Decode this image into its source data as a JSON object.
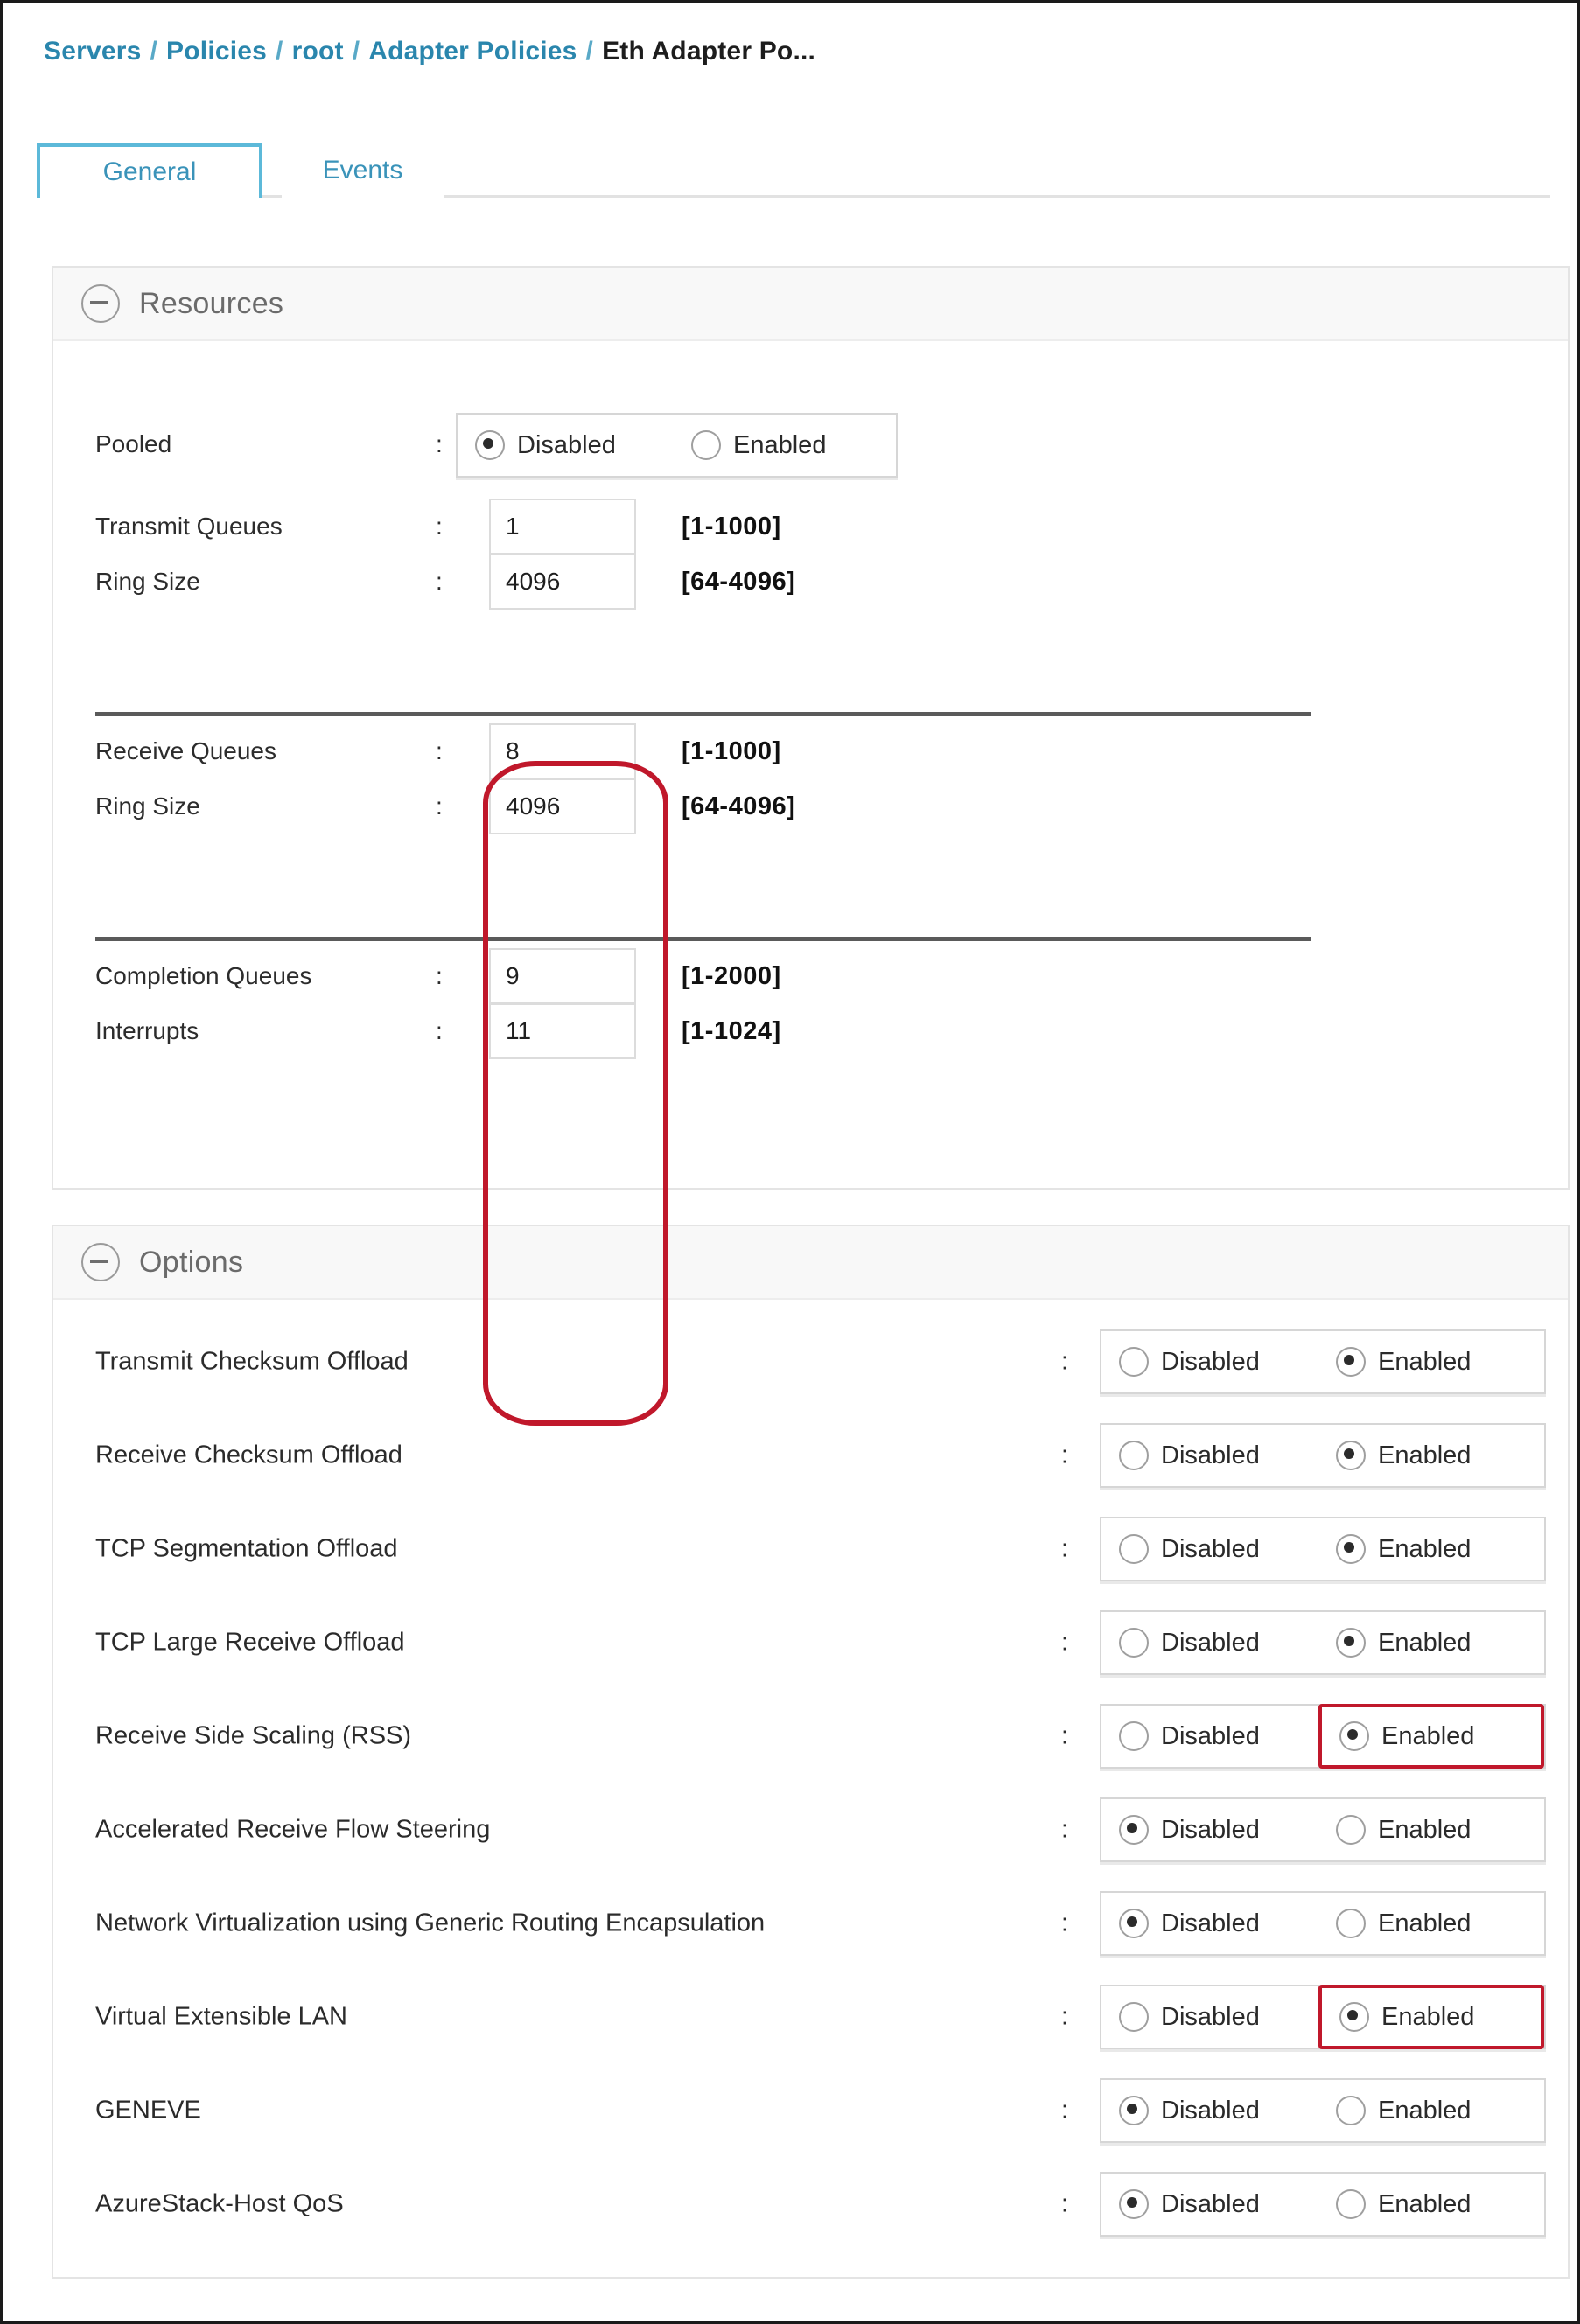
{
  "breadcrumb": {
    "items": [
      {
        "label": "Servers",
        "current": false
      },
      {
        "label": "Policies",
        "current": false
      },
      {
        "label": "root",
        "current": false
      },
      {
        "label": "Adapter Policies",
        "current": false
      },
      {
        "label": "Eth Adapter Po...",
        "current": true
      }
    ],
    "separator": "/"
  },
  "tabs": [
    {
      "label": "General",
      "active": true
    },
    {
      "label": "Events",
      "active": false
    }
  ],
  "colors": {
    "accent": "#5cb9d9",
    "link": "#2a86ad",
    "highlight": "#c0182b",
    "panel_border": "#e4e4e4",
    "panel_header_bg": "#f8f8f8"
  },
  "resources": {
    "title": "Resources",
    "collapse_icon": "minus-circle-icon",
    "pooled": {
      "label": "Pooled",
      "colon": ":",
      "options": [
        {
          "label": "Disabled",
          "selected": true
        },
        {
          "label": "Enabled",
          "selected": false
        }
      ]
    },
    "fields": [
      {
        "label": "Transmit Queues",
        "colon": ":",
        "value": "1",
        "range": "[1-1000]",
        "group": 1
      },
      {
        "label": "Ring Size",
        "colon": ":",
        "value": "4096",
        "range": "[64-4096]",
        "group": 1
      },
      {
        "label": "Receive Queues",
        "colon": ":",
        "value": "8",
        "range": "[1-1000]",
        "group": 2
      },
      {
        "label": "Ring Size",
        "colon": ":",
        "value": "4096",
        "range": "[64-4096]",
        "group": 2
      },
      {
        "label": "Completion Queues",
        "colon": ":",
        "value": "9",
        "range": "[1-2000]",
        "group": 3
      },
      {
        "label": "Interrupts",
        "colon": ":",
        "value": "11",
        "range": "[1-1024]",
        "group": 3
      }
    ]
  },
  "options": {
    "title": "Options",
    "collapse_icon": "minus-circle-icon",
    "colon": ":",
    "disabled_label": "Disabled",
    "enabled_label": "Enabled",
    "rows": [
      {
        "label": "Transmit Checksum Offload",
        "selected": "Enabled",
        "highlighted": false
      },
      {
        "label": "Receive Checksum Offload",
        "selected": "Enabled",
        "highlighted": false
      },
      {
        "label": "TCP Segmentation Offload",
        "selected": "Enabled",
        "highlighted": false
      },
      {
        "label": "TCP Large Receive Offload",
        "selected": "Enabled",
        "highlighted": false
      },
      {
        "label": "Receive Side Scaling (RSS)",
        "selected": "Enabled",
        "highlighted": true
      },
      {
        "label": "Accelerated Receive Flow Steering",
        "selected": "Disabled",
        "highlighted": false
      },
      {
        "label": "Network Virtualization using Generic Routing Encapsulation",
        "selected": "Disabled",
        "highlighted": false
      },
      {
        "label": "Virtual Extensible LAN",
        "selected": "Enabled",
        "highlighted": true
      },
      {
        "label": "GENEVE",
        "selected": "Disabled",
        "highlighted": false
      },
      {
        "label": "AzureStack-Host QoS",
        "selected": "Disabled",
        "highlighted": false
      }
    ]
  }
}
